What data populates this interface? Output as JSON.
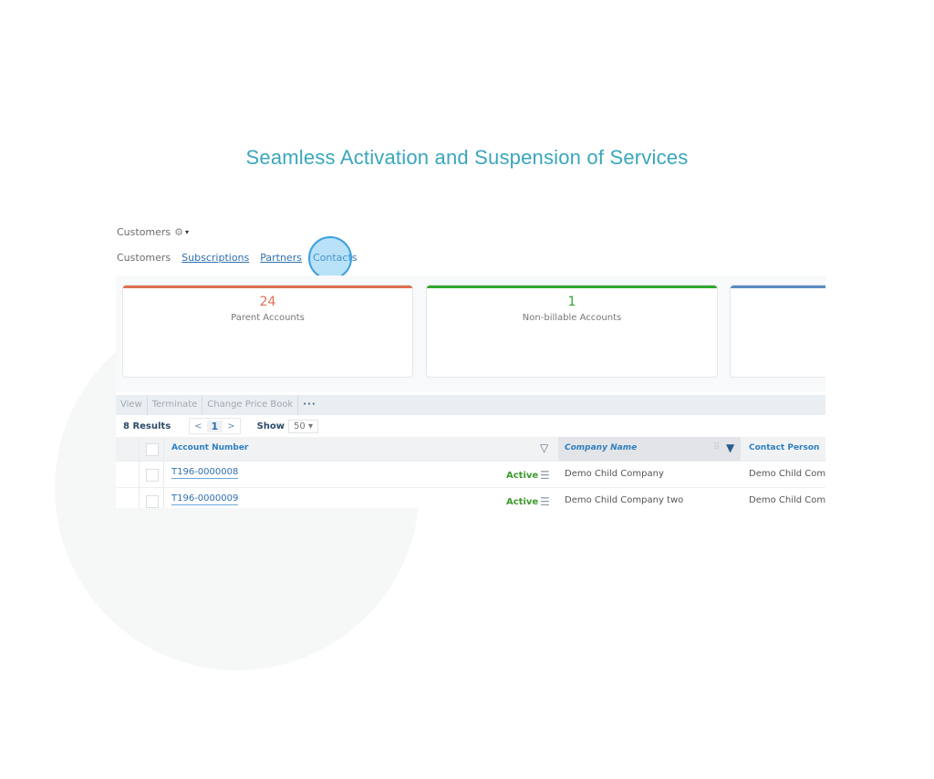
{
  "headline": "Seamless Activation and Suspension of Services",
  "breadcrumb": {
    "title": "Customers",
    "gear_icon": "⚙",
    "caret_icon": "▾"
  },
  "tabs": [
    {
      "label": "Customers",
      "state": "plain"
    },
    {
      "label": "Subscriptions",
      "state": "link"
    },
    {
      "label": "Partners",
      "state": "link"
    },
    {
      "label": "Contacts",
      "state": "highlighted"
    }
  ],
  "kpis": [
    {
      "value": "24",
      "label": "Parent Accounts",
      "color": "#e07050"
    },
    {
      "value": "1",
      "label": "Non-billable Accounts",
      "color": "#2ea82e"
    },
    {
      "value": "",
      "label": "",
      "color": "#5b8bc0"
    }
  ],
  "actions": {
    "view": "View",
    "terminate": "Terminate",
    "change_price_book": "Change Price Book",
    "more": "···"
  },
  "pager": {
    "results": "8 Results",
    "prev": "<",
    "page": "1",
    "next": ">",
    "show_label": "Show",
    "page_size": "50",
    "caret": "▾"
  },
  "table": {
    "columns": {
      "account_number": "Account Number",
      "company_name": "Company Name",
      "contact_person": "Contact Person"
    },
    "filter_icon": "▽",
    "filter_active_icon": "▼",
    "grip_icon": "⠿",
    "menu_icon": "☰",
    "rows": [
      {
        "account_number": "T196-0000008",
        "status": "Active",
        "company_name": "Demo Child Company",
        "contact_person": "Demo Child Com"
      },
      {
        "account_number": "T196-0000009",
        "status": "Active",
        "company_name": "Demo Child Company two",
        "contact_person": "Demo Child Com"
      }
    ]
  }
}
